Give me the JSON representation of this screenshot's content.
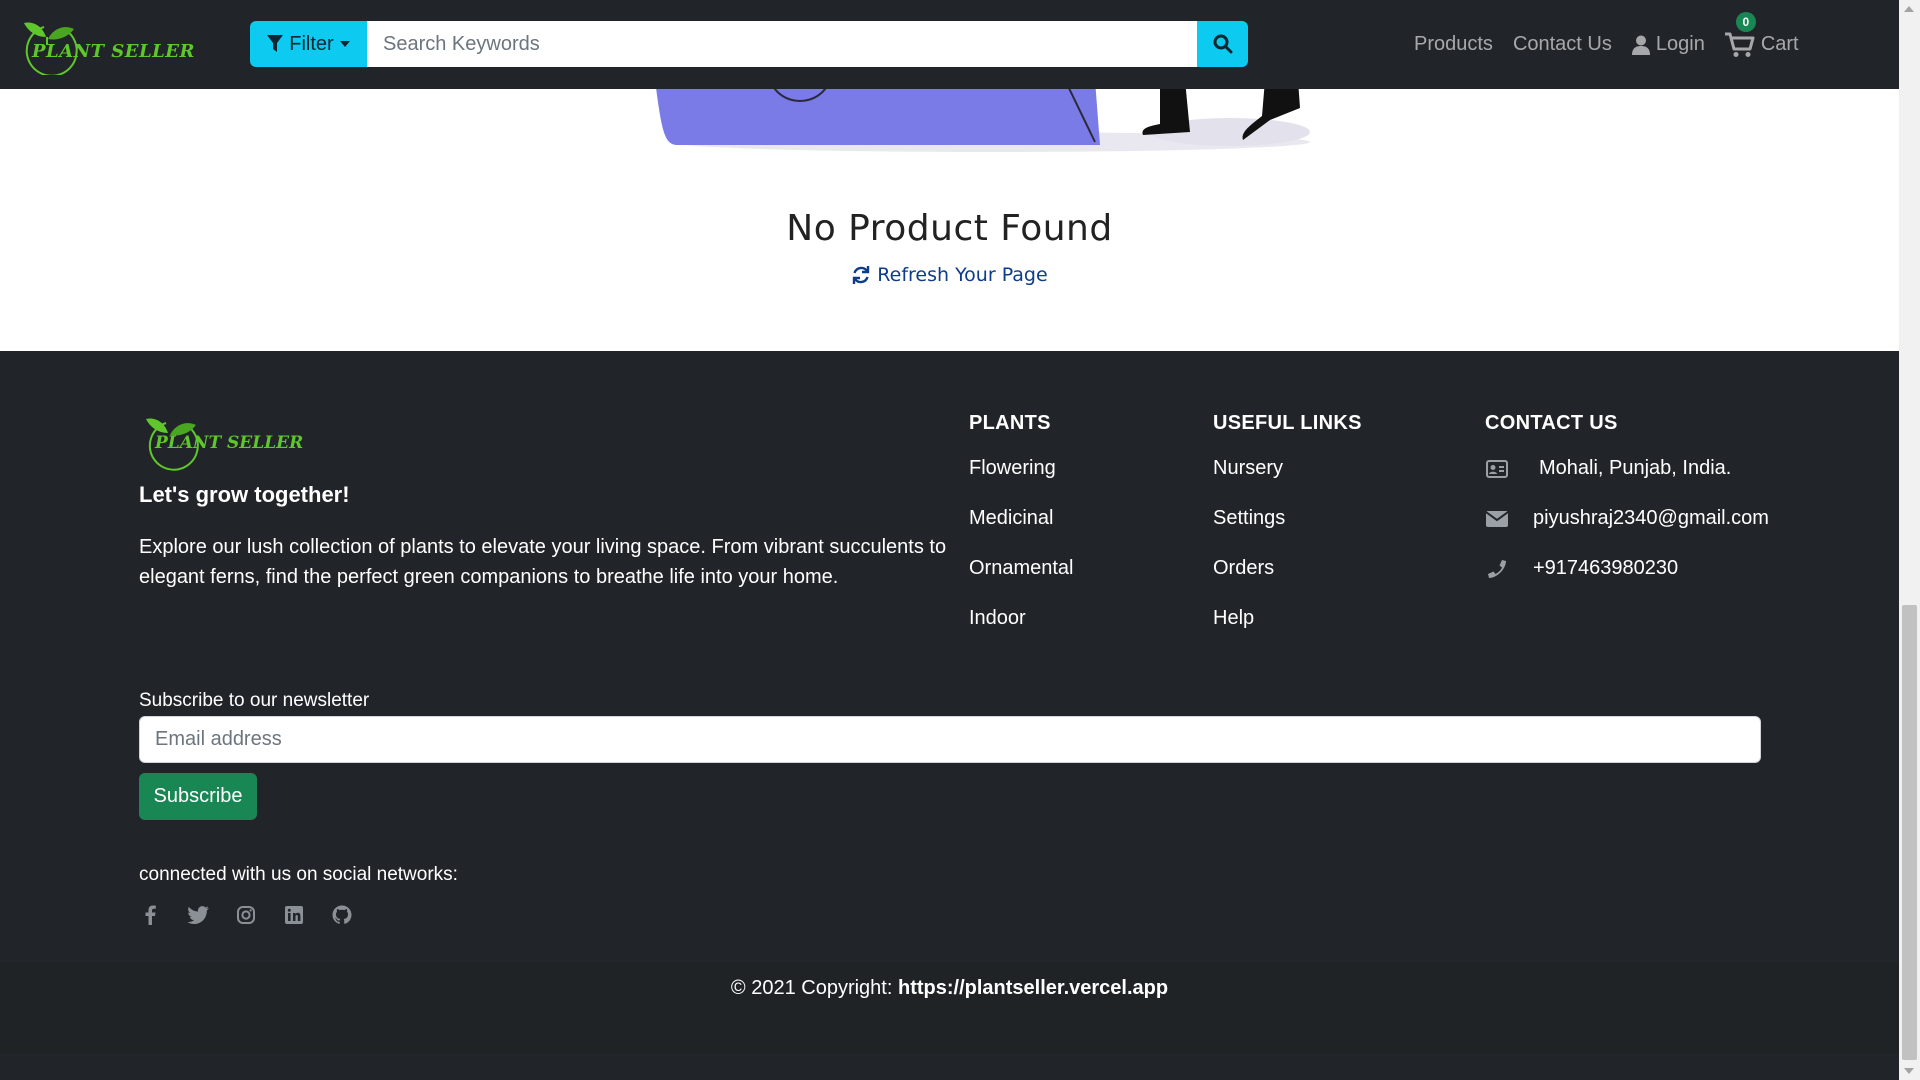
{
  "navbar": {
    "brand": "PLANT SELLER",
    "filter_label": "Filter",
    "search_placeholder": "Search Keywords",
    "links": {
      "products": "Products",
      "contact": "Contact Us",
      "login": "Login",
      "cart": "Cart",
      "cart_count": "0"
    }
  },
  "main": {
    "empty_title": "No Product Found",
    "refresh_label": "Refresh Your Page"
  },
  "footer": {
    "brand": "PLANT SELLER",
    "tagline": "Let's grow together!",
    "about": "Explore our lush collection of plants to elevate your living space. From vibrant succulents to elegant ferns, find the perfect green companions to breathe life into your home.",
    "plants": {
      "heading": "PLANTS",
      "items": [
        "Flowering",
        "Medicinal",
        "Ornamental",
        "Indoor"
      ]
    },
    "useful_links": {
      "heading": "USEFUL LINKS",
      "items": [
        "Nursery",
        "Settings",
        "Orders",
        "Help"
      ]
    },
    "contact": {
      "heading": "CONTACT US",
      "address": "Mohali, Punjab, India.",
      "email": "piyushraj2340@gmail.com",
      "phone": "+917463980230"
    },
    "newsletter": {
      "label": "Subscribe to our newsletter",
      "placeholder": "Email address",
      "button": "Subscribe"
    },
    "social": {
      "label": "connected with us on social networks:",
      "icons": [
        "facebook-icon",
        "twitter-icon",
        "instagram-icon",
        "linkedin-icon",
        "github-icon"
      ]
    },
    "copyright_prefix": "© 2021 Copyright: ",
    "copyright_link": "https://plantseller.vercel.app"
  }
}
